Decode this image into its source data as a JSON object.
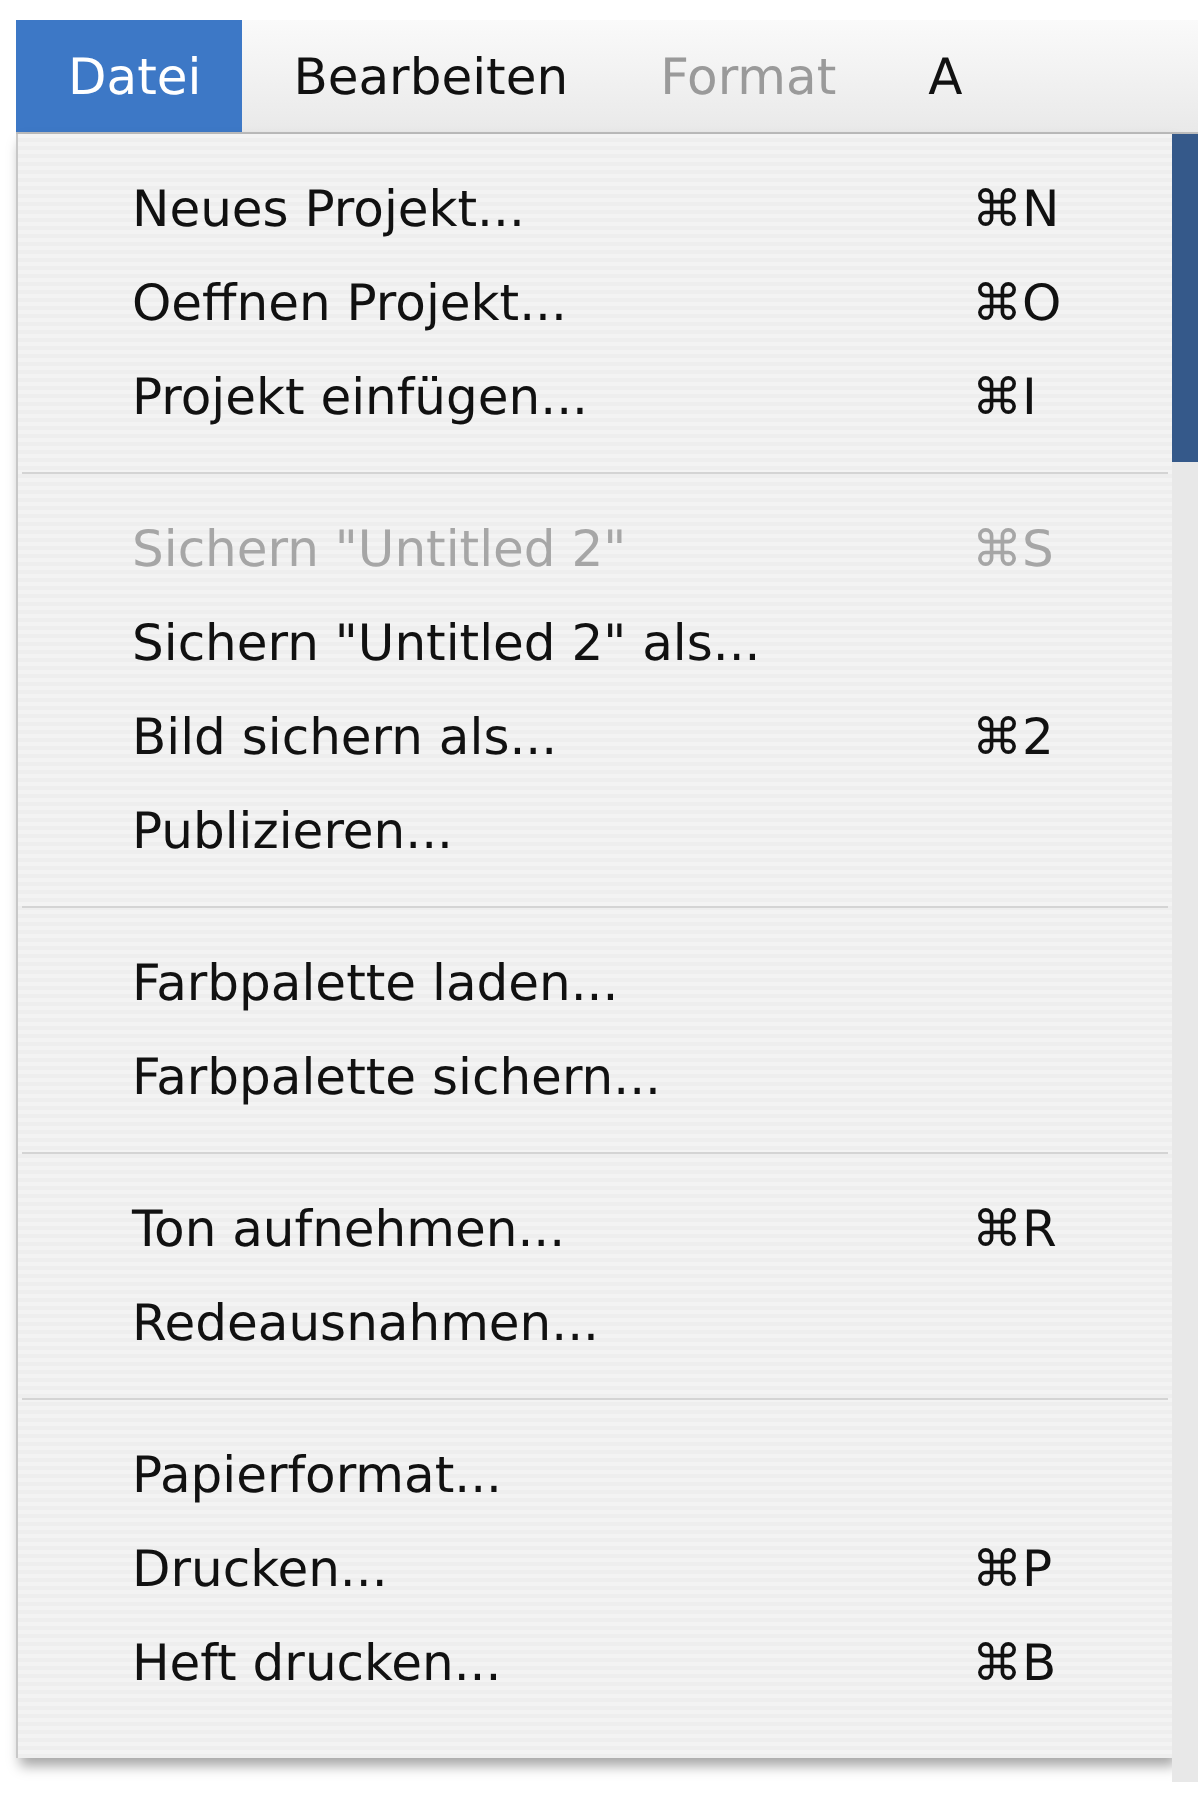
{
  "menubar": [
    {
      "label": "Datei",
      "selected": true,
      "disabled": false
    },
    {
      "label": "Bearbeiten",
      "selected": false,
      "disabled": false
    },
    {
      "label": "Format",
      "selected": false,
      "disabled": true
    },
    {
      "label": "A",
      "selected": false,
      "disabled": false
    }
  ],
  "menu": {
    "sections": [
      {
        "items": [
          {
            "label": "Neues Projekt...",
            "shortcut": "⌘N",
            "disabled": false
          },
          {
            "label": "Oeffnen Projekt...",
            "shortcut": "⌘O",
            "disabled": false
          },
          {
            "label": "Projekt einfügen...",
            "shortcut": "⌘I",
            "disabled": false
          }
        ]
      },
      {
        "items": [
          {
            "label": "Sichern \"Untitled 2\"",
            "shortcut": "⌘S",
            "disabled": true
          },
          {
            "label": "Sichern \"Untitled 2\" als...",
            "disabled": false
          },
          {
            "label": "Bild sichern als...",
            "shortcut": "⌘2",
            "disabled": false
          },
          {
            "label": "Publizieren...",
            "disabled": false
          }
        ]
      },
      {
        "items": [
          {
            "label": "Farbpalette laden...",
            "disabled": false
          },
          {
            "label": "Farbpalette sichern...",
            "disabled": false
          }
        ]
      },
      {
        "items": [
          {
            "label": "Ton aufnehmen...",
            "shortcut": "⌘R",
            "disabled": false
          },
          {
            "label": "Redeausnahmen...",
            "disabled": false
          }
        ]
      },
      {
        "items": [
          {
            "label": "Papierformat...",
            "disabled": false
          },
          {
            "label": "Drucken...",
            "shortcut": "⌘P",
            "disabled": false
          },
          {
            "label": "Heft drucken...",
            "shortcut": "⌘B",
            "disabled": false
          }
        ]
      }
    ]
  }
}
